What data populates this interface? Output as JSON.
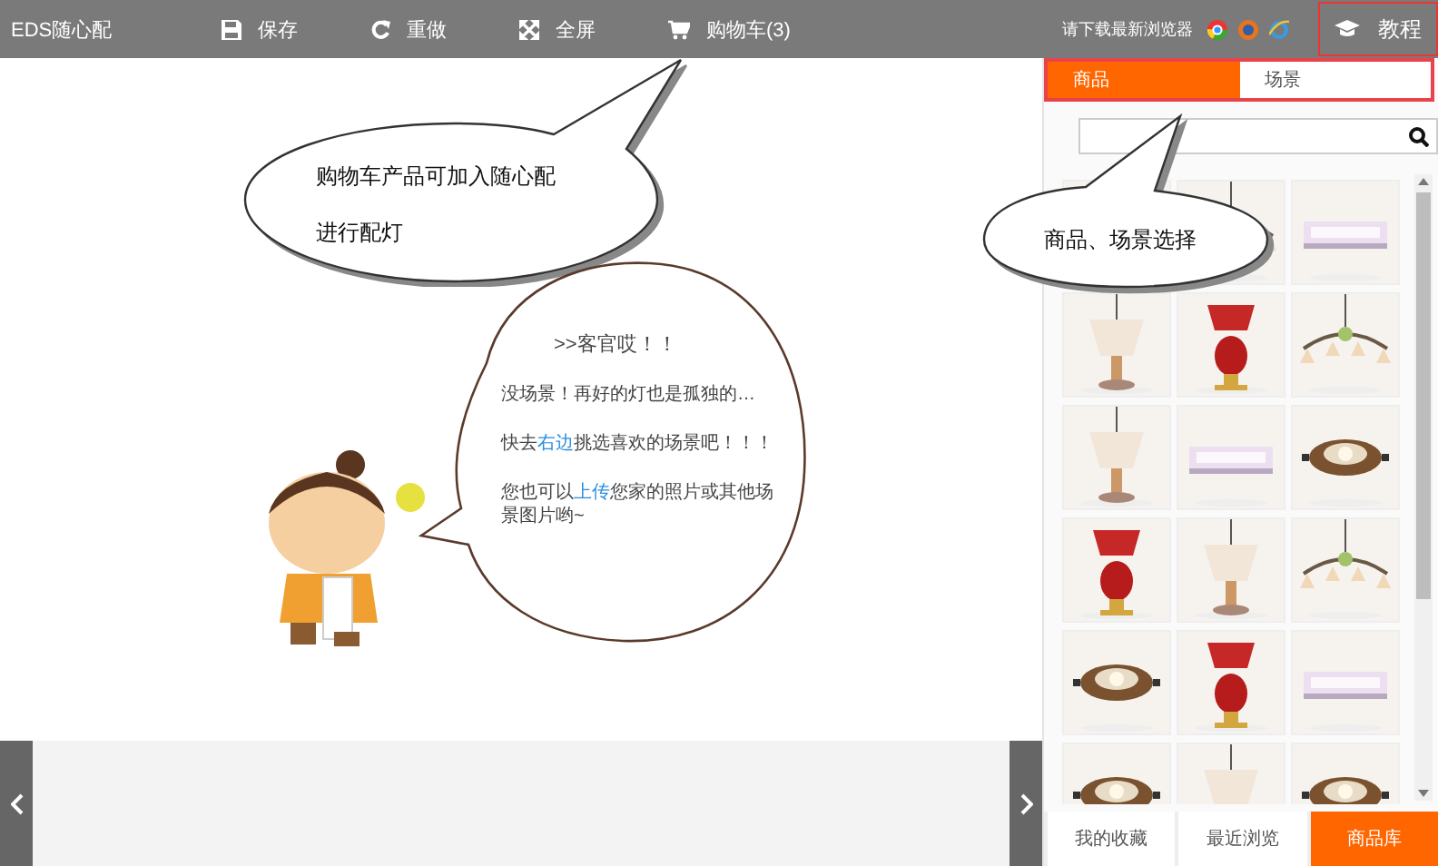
{
  "app_title": "EDS随心配",
  "toolbar": [
    {
      "kind": "save",
      "label": "保存"
    },
    {
      "kind": "redo",
      "label": "重做"
    },
    {
      "kind": "fullscreen",
      "label": "全屏"
    },
    {
      "kind": "cart",
      "label": "购物车(3)"
    }
  ],
  "browser_notice": "请下载最新浏览器",
  "tutorial_button": {
    "label": "教程"
  },
  "panel_tabs": [
    {
      "label": "商品",
      "selected": true
    },
    {
      "label": "场景",
      "selected": false
    }
  ],
  "bottom_tabs": [
    {
      "label": "我的收藏",
      "selected": false
    },
    {
      "label": "最近浏览",
      "selected": false
    },
    {
      "label": "商品库",
      "selected": true
    }
  ],
  "callouts": [
    {
      "lines": [
        "购物车产品可加入随心配",
        "进行配灯"
      ]
    },
    {
      "lines": [
        "商品、场景选择"
      ]
    }
  ],
  "speech": {
    "title": ">>客官哎！！",
    "lines": [
      "没场景！再好的灯也是孤独的…",
      "快去**右边**挑选喜欢的场景吧！！！",
      "您也可以**上传**您家的照片或其他场景图片哟~"
    ]
  }
}
